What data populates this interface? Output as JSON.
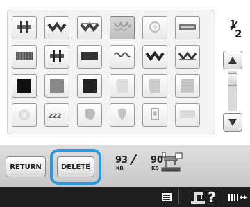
{
  "page": {
    "current": "1",
    "total": "2"
  },
  "patterns": [
    {
      "name": "border-pattern-1"
    },
    {
      "name": "border-pattern-2"
    },
    {
      "name": "border-pattern-3"
    },
    {
      "name": "border-pattern-4",
      "selected": true
    },
    {
      "name": "border-pattern-5"
    },
    {
      "name": "border-pattern-6"
    },
    {
      "name": "border-pattern-7"
    },
    {
      "name": "border-pattern-8"
    },
    {
      "name": "border-pattern-9"
    },
    {
      "name": "border-pattern-10"
    },
    {
      "name": "border-pattern-11"
    },
    {
      "name": "border-pattern-12"
    },
    {
      "name": "border-pattern-13"
    },
    {
      "name": "border-pattern-14"
    },
    {
      "name": "border-pattern-15"
    },
    {
      "name": "border-pattern-16"
    },
    {
      "name": "border-pattern-17"
    },
    {
      "name": "border-pattern-18"
    },
    {
      "name": "border-pattern-19"
    },
    {
      "name": "border-pattern-20"
    },
    {
      "name": "border-pattern-21"
    },
    {
      "name": "border-pattern-22"
    },
    {
      "name": "border-pattern-23"
    },
    {
      "name": "border-pattern-24"
    }
  ],
  "controls": {
    "return_label": "RETURN",
    "delete_label": "DELETE"
  },
  "memory": {
    "available_value": "93",
    "available_unit": "KB",
    "used_value": "90",
    "used_unit": "KB"
  },
  "colors": {
    "highlight": "#2a9ae0",
    "status_bar": "#1f1f1f",
    "control_bg": "#d4d4d4"
  },
  "icons": {
    "scroll_up": "triangle-up-icon",
    "scroll_down": "triangle-down-icon",
    "machine": "embroidery-machine-icon",
    "list": "list-icon",
    "help": "machine-help-icon",
    "horizontal_scroll": "horizontal-scroll-icon"
  }
}
